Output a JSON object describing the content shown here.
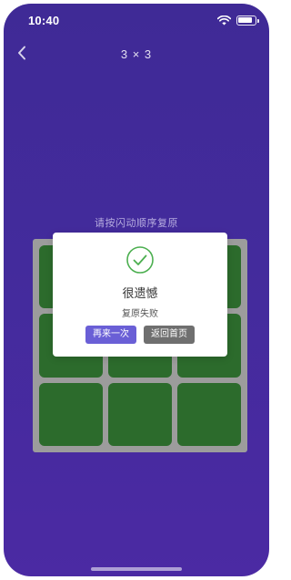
{
  "status_bar": {
    "time": "10:40",
    "battery_level": 0.9
  },
  "nav": {
    "title": "3 × 3",
    "back_icon": "chevron-left-icon"
  },
  "instruction": "请按闪动顺序复原",
  "grid": {
    "rows": 3,
    "cols": 3,
    "cell_color": "#2c6b2c",
    "board_color": "#9c9c9c"
  },
  "dialog": {
    "icon": "check-circle-icon",
    "icon_color": "#4caf50",
    "title": "很遗憾",
    "message": "复原失败",
    "retry_label": "再来一次",
    "home_label": "返回首页"
  },
  "colors": {
    "background": "#3f2a96",
    "retry_button": "#6a5fd6",
    "home_button": "#6f6f6f"
  }
}
